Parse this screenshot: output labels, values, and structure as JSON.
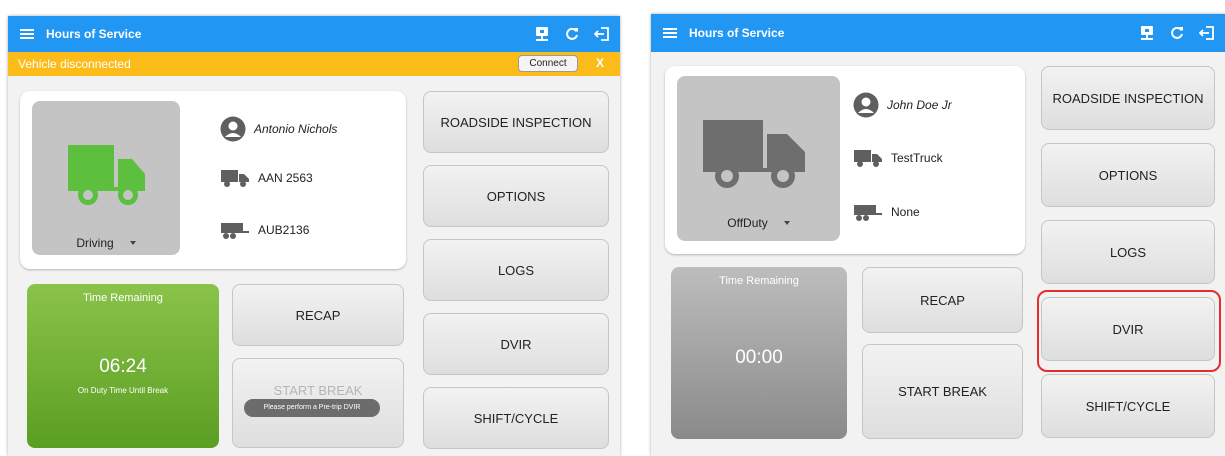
{
  "left": {
    "appbar": {
      "title": "Hours of Service",
      "icons": [
        "menu-icon",
        "eld-device-icon",
        "refresh-icon",
        "logout-icon"
      ]
    },
    "banner": {
      "message": "Vehicle disconnected",
      "connect_label": "Connect",
      "dismiss_label": "X"
    },
    "status_card": {
      "duty_status": "Driving",
      "driver": "Antonio Nichols",
      "truck": "AAN 2563",
      "trailer": "AUB2136",
      "truck_color": "#5cbf3e"
    },
    "time_remaining": {
      "label": "Time Remaining",
      "value": "06:24",
      "subtitle": "On Duty Time Until Break"
    },
    "buttons": {
      "roadside": "ROADSIDE INSPECTION",
      "options": "OPTIONS",
      "logs": "LOGS",
      "dvir": "DVIR",
      "shift_cycle": "SHIFT/CYCLE",
      "recap": "RECAP",
      "start_break": "START BREAK"
    },
    "toast": "Please perform a Pre-trip DVIR"
  },
  "right": {
    "appbar": {
      "title": "Hours of Service",
      "icons": [
        "menu-icon",
        "eld-device-icon",
        "refresh-icon",
        "logout-icon"
      ]
    },
    "status_card": {
      "duty_status": "OffDuty",
      "driver": "John Doe Jr",
      "truck": "TestTruck",
      "trailer": "None",
      "truck_color": "#6e6e6e"
    },
    "time_remaining": {
      "label": "Time Remaining",
      "value": "00:00"
    },
    "buttons": {
      "roadside": "ROADSIDE INSPECTION",
      "options": "OPTIONS",
      "logs": "LOGS",
      "dvir": "DVIR",
      "shift_cycle": "SHIFT/CYCLE",
      "recap": "RECAP",
      "start_break": "START BREAK"
    },
    "highlighted": "DVIR"
  },
  "colors": {
    "appbar": "#2196f3",
    "banner": "#fbbc1a",
    "time_active": "#7ab648",
    "highlight": "#e52d2d"
  }
}
